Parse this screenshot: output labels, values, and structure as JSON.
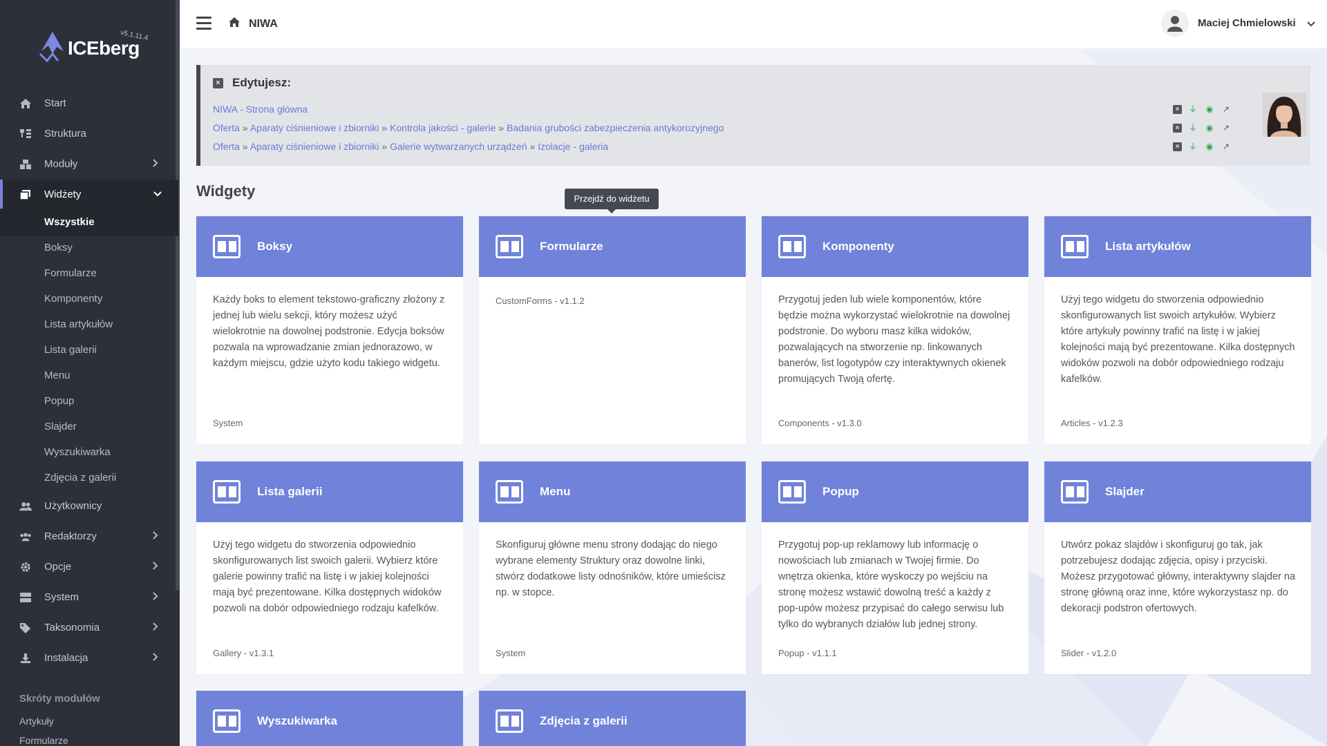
{
  "app": {
    "name": "ICEberg",
    "version": "v5.1.11.4"
  },
  "sidebar": {
    "items": [
      {
        "label": "Start",
        "icon": "home-icon"
      },
      {
        "label": "Struktura",
        "icon": "sitemap-icon"
      },
      {
        "label": "Moduły",
        "icon": "cubes-icon"
      },
      {
        "label": "Widżety",
        "icon": "clone-icon"
      }
    ],
    "widget_sub": [
      "Wszystkie",
      "Boksy",
      "Formularze",
      "Komponenty",
      "Lista artykułów",
      "Lista galerii",
      "Menu",
      "Popup",
      "Slajder",
      "Wyszukiwarka",
      "Zdjęcia z galerii"
    ],
    "items2": [
      {
        "label": "Użytkownicy"
      },
      {
        "label": "Redaktorzy"
      },
      {
        "label": "Opcje"
      },
      {
        "label": "System"
      },
      {
        "label": "Taksonomia"
      },
      {
        "label": "Instalacja"
      }
    ],
    "shortcuts_title": "Skróty modułów",
    "shortcuts": [
      "Artykuły",
      "Formularze"
    ]
  },
  "topbar": {
    "breadcrumb": "NIWA",
    "user_name": "Maciej Chmielowski"
  },
  "editing": {
    "title": "Edytujesz:",
    "row1": {
      "link": "NIWA - Strona główna"
    },
    "row2": {
      "l1": "Oferta",
      "sep": "»",
      "l2": "Aparaty ciśnieniowe i zbiorniki",
      "l3": "Kontrola jakości - galerie",
      "l4": "Badania grubości zabezpieczenia antykorozyjnego"
    },
    "row3": {
      "l1": "Oferta",
      "sep": "»",
      "l2": "Aparaty ciśnieniowe i zbiorniki",
      "l3": "Galerie wytwarzanych urządzeń",
      "l4": "Izolacje - galeria"
    }
  },
  "section_title": "Widgety",
  "tooltip": "Przejdź do widżetu",
  "cards": [
    {
      "title": "Boksy",
      "desc": "Każdy boks to element tekstowo-graficzny złożony z jednej lub wielu sekcji, który możesz użyć wielokrotnie na dowolnej podstronie. Edycja boksów pozwala na wprowadzanie zmian jednorazowo, w każdym miejscu, gdzie użyto kodu takiego widgetu.",
      "footer": "System"
    },
    {
      "title": "Formularze",
      "desc": "",
      "footer": "CustomForms - v1.1.2"
    },
    {
      "title": "Komponenty",
      "desc": "Przygotuj jeden lub wiele komponentów, które będzie można wykorzystać wielokrotnie na dowolnej podstronie. Do wyboru masz kilka widoków, pozwalających na stworzenie np. linkowanych banerów, list logotypów czy interaktywnych okienek promujących Twoją ofertę.",
      "footer": "Components - v1.3.0"
    },
    {
      "title": "Lista artykułów",
      "desc": "Użyj tego widgetu do stworzenia odpowiednio skonfigurowanych list swoich artykułów. Wybierz które artykuły powinny trafić na listę i w jakiej kolejności mają być prezentowane. Kilka dostępnych widoków pozwoli na dobór odpowiedniego rodzaju kafelków.",
      "footer": "Articles - v1.2.3"
    },
    {
      "title": "Lista galerii",
      "desc": "Użyj tego widgetu do stworzenia odpowiednio skonfigurowanych list swoich galerii. Wybierz które galerie powinny trafić na listę i w jakiej kolejności mają być prezentowane. Kilka dostępnych widoków pozwoli na dobór odpowiedniego rodzaju kafelków.",
      "footer": "Gallery - v1.3.1"
    },
    {
      "title": "Menu",
      "desc": "Skonfiguruj główne menu strony dodając do niego wybrane elementy Struktury oraz dowolne linki, stwórz dodatkowe listy odnośników, które umieścisz np. w stopce.",
      "footer": "System"
    },
    {
      "title": "Popup",
      "desc": "Przygotuj pop-up reklamowy lub informację o nowościach lub zmianach w Twojej firmie. Do wnętrza okienka, które wyskoczy po wejściu na stronę możesz wstawić dowolną treść a każdy z pop-upów możesz przypisać do całego serwisu lub tylko do wybranych działów lub jednej strony.",
      "footer": "Popup - v1.1.1"
    },
    {
      "title": "Slajder",
      "desc": "Utwórz pokaz slajdów i skonfiguruj go tak, jak potrzebujesz dodając zdjęcia, opisy i przyciski. Możesz przygotować główny, interaktywny slajder na stronę główną oraz inne, które wykorzystasz np. do dekoracji podstron ofertowych.",
      "footer": "Slider - v1.2.0"
    },
    {
      "title": "Wyszukiwarka",
      "desc": "",
      "footer": ""
    },
    {
      "title": "Zdjęcia z galerii",
      "desc": "",
      "footer": ""
    }
  ],
  "colors": {
    "sidebar_bg": "#2d3039",
    "accent": "#7082d9",
    "link": "#6a79d3"
  }
}
